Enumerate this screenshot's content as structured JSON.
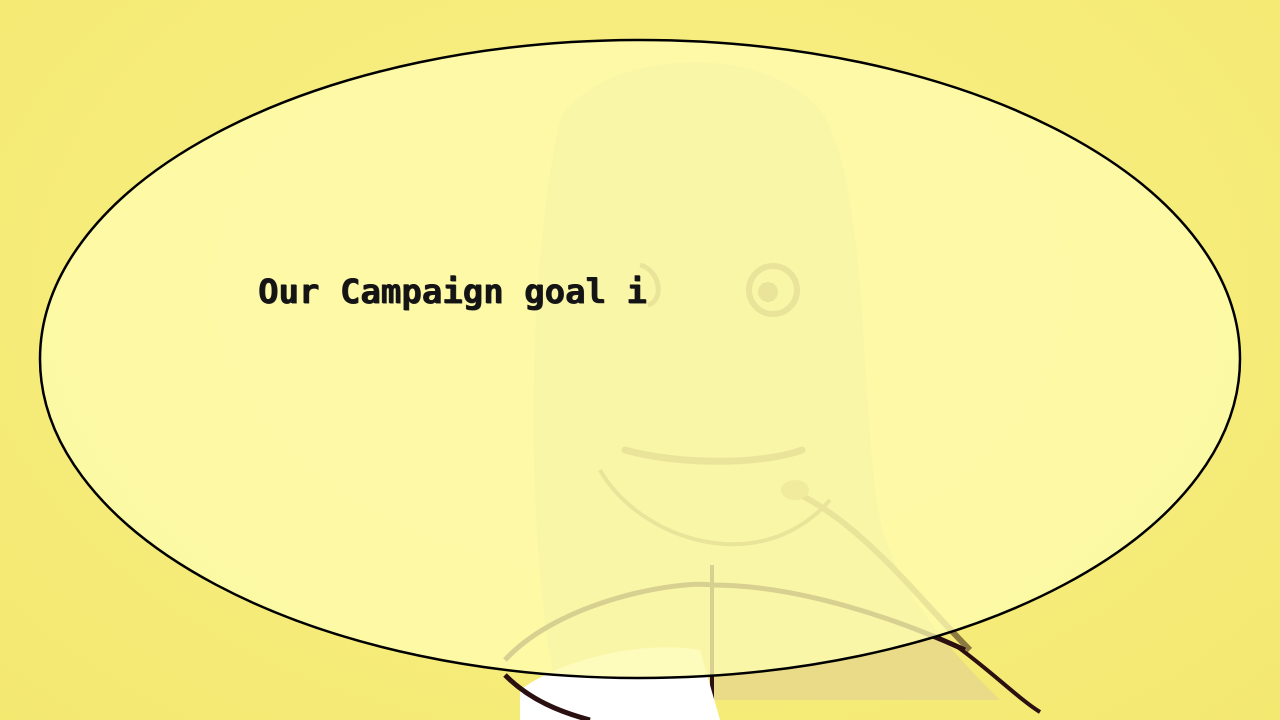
{
  "scene": {
    "background_color": "#f6ec7a",
    "bubble_fill": "#fdfaa8",
    "bubble_stroke": "#000000",
    "character_line_color": "#2a1010",
    "character_shirt_color": "#ffffff"
  },
  "speech": {
    "text": "Our Campaign goal i"
  }
}
